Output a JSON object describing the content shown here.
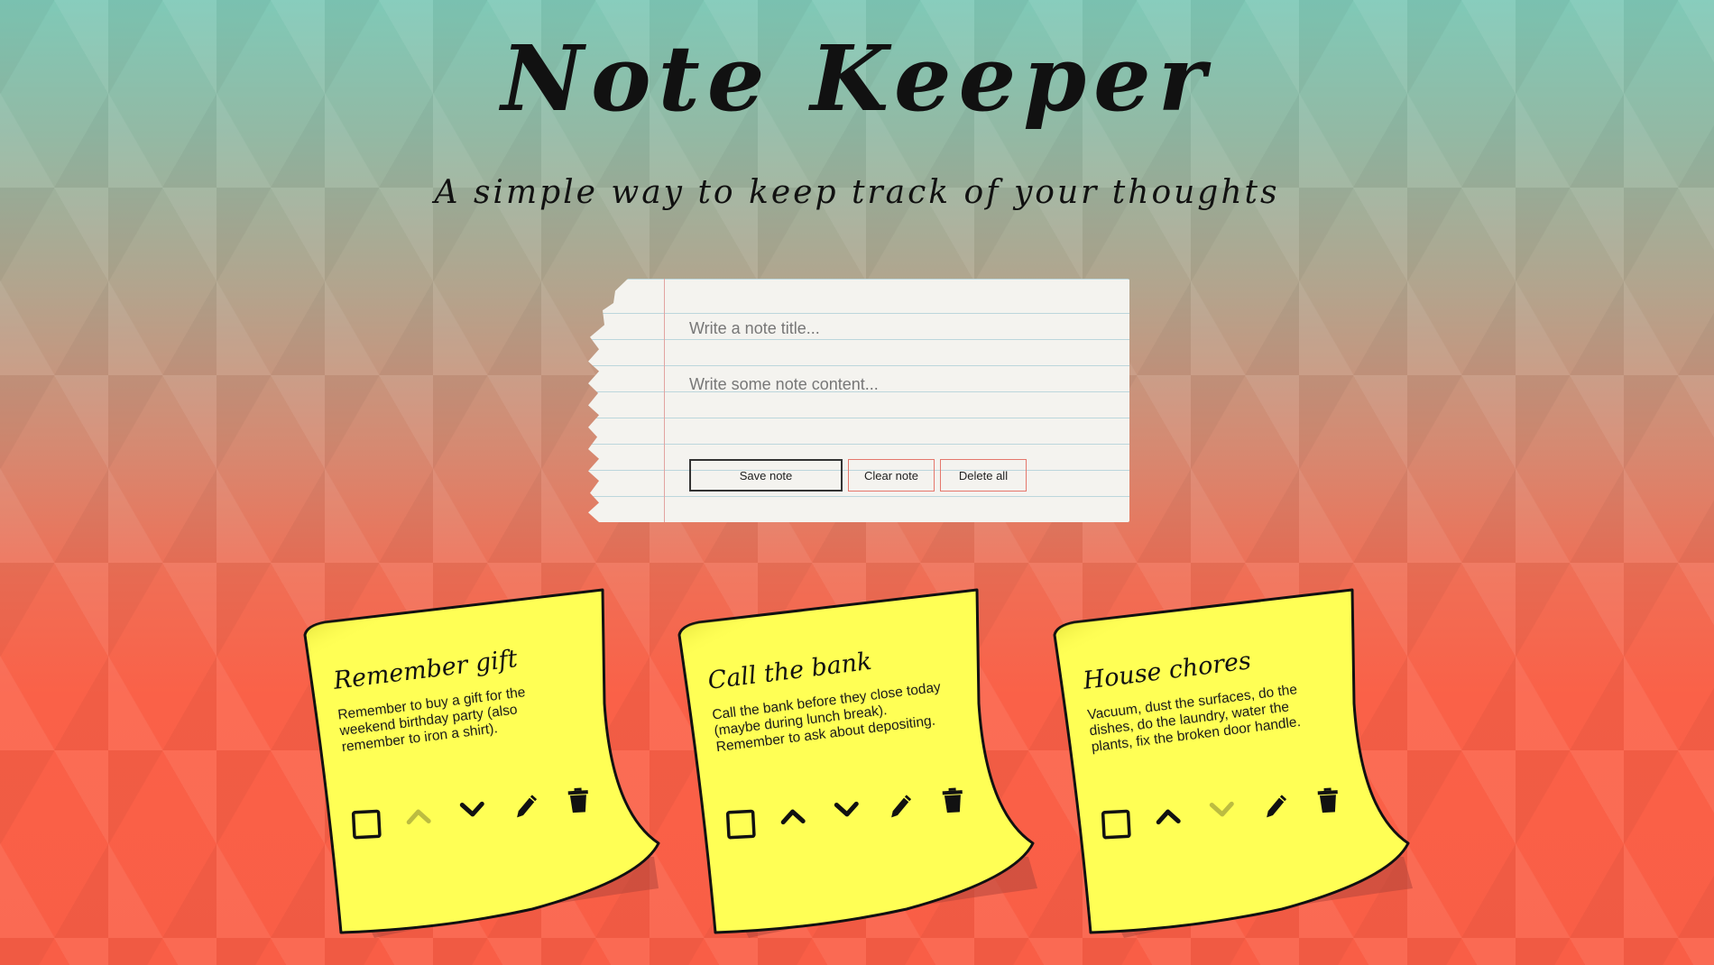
{
  "header": {
    "title": "Note Keeper",
    "subtitle": "A simple way to keep track of your thoughts"
  },
  "form": {
    "title_placeholder": "Write a note title...",
    "content_placeholder": "Write some note content...",
    "save_label": "Save note",
    "clear_label": "Clear note",
    "delete_all_label": "Delete all"
  },
  "notes": [
    {
      "title": "Remember gift",
      "content": "Remember to buy a gift for the weekend birthday party (also remember to iron a shirt).",
      "done": false,
      "up_enabled": false,
      "down_enabled": true
    },
    {
      "title": "Call the bank",
      "content": "Call the bank before they close today (maybe during lunch break). Remember to ask about depositing.",
      "done": false,
      "up_enabled": true,
      "down_enabled": true
    },
    {
      "title": "House chores",
      "content": "Vacuum, dust the surfaces, do the dishes, do the laundry, water the plants, fix the broken door handle.",
      "done": false,
      "up_enabled": true,
      "down_enabled": false
    }
  ],
  "icons": {
    "checkbox": "square-checkbox-icon",
    "move_up": "chevron-up-icon",
    "move_down": "chevron-down-icon",
    "edit": "pencil-icon",
    "delete": "trash-icon"
  },
  "colors": {
    "note_yellow": "#ffff55",
    "button_border_accent": "#e5776c",
    "background_top": "#7fc9b7",
    "background_bottom": "#f95e46"
  }
}
